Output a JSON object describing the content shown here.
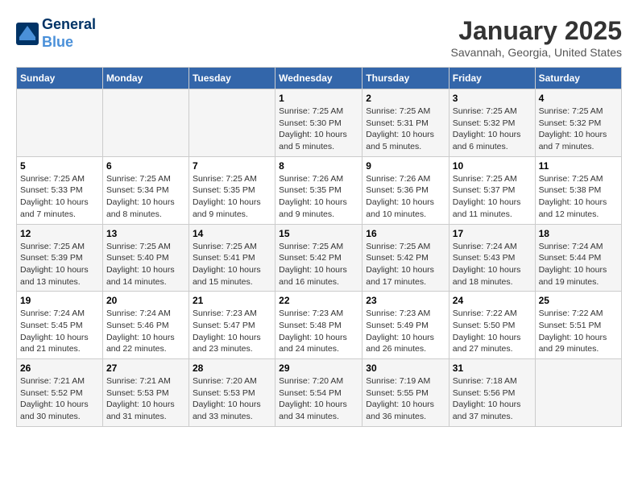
{
  "header": {
    "logo_line1": "General",
    "logo_line2": "Blue",
    "title": "January 2025",
    "subtitle": "Savannah, Georgia, United States"
  },
  "days_of_week": [
    "Sunday",
    "Monday",
    "Tuesday",
    "Wednesday",
    "Thursday",
    "Friday",
    "Saturday"
  ],
  "weeks": [
    [
      {
        "day": "",
        "info": ""
      },
      {
        "day": "",
        "info": ""
      },
      {
        "day": "",
        "info": ""
      },
      {
        "day": "1",
        "info": "Sunrise: 7:25 AM\nSunset: 5:30 PM\nDaylight: 10 hours\nand 5 minutes."
      },
      {
        "day": "2",
        "info": "Sunrise: 7:25 AM\nSunset: 5:31 PM\nDaylight: 10 hours\nand 5 minutes."
      },
      {
        "day": "3",
        "info": "Sunrise: 7:25 AM\nSunset: 5:32 PM\nDaylight: 10 hours\nand 6 minutes."
      },
      {
        "day": "4",
        "info": "Sunrise: 7:25 AM\nSunset: 5:32 PM\nDaylight: 10 hours\nand 7 minutes."
      }
    ],
    [
      {
        "day": "5",
        "info": "Sunrise: 7:25 AM\nSunset: 5:33 PM\nDaylight: 10 hours\nand 7 minutes."
      },
      {
        "day": "6",
        "info": "Sunrise: 7:25 AM\nSunset: 5:34 PM\nDaylight: 10 hours\nand 8 minutes."
      },
      {
        "day": "7",
        "info": "Sunrise: 7:25 AM\nSunset: 5:35 PM\nDaylight: 10 hours\nand 9 minutes."
      },
      {
        "day": "8",
        "info": "Sunrise: 7:26 AM\nSunset: 5:35 PM\nDaylight: 10 hours\nand 9 minutes."
      },
      {
        "day": "9",
        "info": "Sunrise: 7:26 AM\nSunset: 5:36 PM\nDaylight: 10 hours\nand 10 minutes."
      },
      {
        "day": "10",
        "info": "Sunrise: 7:25 AM\nSunset: 5:37 PM\nDaylight: 10 hours\nand 11 minutes."
      },
      {
        "day": "11",
        "info": "Sunrise: 7:25 AM\nSunset: 5:38 PM\nDaylight: 10 hours\nand 12 minutes."
      }
    ],
    [
      {
        "day": "12",
        "info": "Sunrise: 7:25 AM\nSunset: 5:39 PM\nDaylight: 10 hours\nand 13 minutes."
      },
      {
        "day": "13",
        "info": "Sunrise: 7:25 AM\nSunset: 5:40 PM\nDaylight: 10 hours\nand 14 minutes."
      },
      {
        "day": "14",
        "info": "Sunrise: 7:25 AM\nSunset: 5:41 PM\nDaylight: 10 hours\nand 15 minutes."
      },
      {
        "day": "15",
        "info": "Sunrise: 7:25 AM\nSunset: 5:42 PM\nDaylight: 10 hours\nand 16 minutes."
      },
      {
        "day": "16",
        "info": "Sunrise: 7:25 AM\nSunset: 5:42 PM\nDaylight: 10 hours\nand 17 minutes."
      },
      {
        "day": "17",
        "info": "Sunrise: 7:24 AM\nSunset: 5:43 PM\nDaylight: 10 hours\nand 18 minutes."
      },
      {
        "day": "18",
        "info": "Sunrise: 7:24 AM\nSunset: 5:44 PM\nDaylight: 10 hours\nand 19 minutes."
      }
    ],
    [
      {
        "day": "19",
        "info": "Sunrise: 7:24 AM\nSunset: 5:45 PM\nDaylight: 10 hours\nand 21 minutes."
      },
      {
        "day": "20",
        "info": "Sunrise: 7:24 AM\nSunset: 5:46 PM\nDaylight: 10 hours\nand 22 minutes."
      },
      {
        "day": "21",
        "info": "Sunrise: 7:23 AM\nSunset: 5:47 PM\nDaylight: 10 hours\nand 23 minutes."
      },
      {
        "day": "22",
        "info": "Sunrise: 7:23 AM\nSunset: 5:48 PM\nDaylight: 10 hours\nand 24 minutes."
      },
      {
        "day": "23",
        "info": "Sunrise: 7:23 AM\nSunset: 5:49 PM\nDaylight: 10 hours\nand 26 minutes."
      },
      {
        "day": "24",
        "info": "Sunrise: 7:22 AM\nSunset: 5:50 PM\nDaylight: 10 hours\nand 27 minutes."
      },
      {
        "day": "25",
        "info": "Sunrise: 7:22 AM\nSunset: 5:51 PM\nDaylight: 10 hours\nand 29 minutes."
      }
    ],
    [
      {
        "day": "26",
        "info": "Sunrise: 7:21 AM\nSunset: 5:52 PM\nDaylight: 10 hours\nand 30 minutes."
      },
      {
        "day": "27",
        "info": "Sunrise: 7:21 AM\nSunset: 5:53 PM\nDaylight: 10 hours\nand 31 minutes."
      },
      {
        "day": "28",
        "info": "Sunrise: 7:20 AM\nSunset: 5:53 PM\nDaylight: 10 hours\nand 33 minutes."
      },
      {
        "day": "29",
        "info": "Sunrise: 7:20 AM\nSunset: 5:54 PM\nDaylight: 10 hours\nand 34 minutes."
      },
      {
        "day": "30",
        "info": "Sunrise: 7:19 AM\nSunset: 5:55 PM\nDaylight: 10 hours\nand 36 minutes."
      },
      {
        "day": "31",
        "info": "Sunrise: 7:18 AM\nSunset: 5:56 PM\nDaylight: 10 hours\nand 37 minutes."
      },
      {
        "day": "",
        "info": ""
      }
    ]
  ]
}
